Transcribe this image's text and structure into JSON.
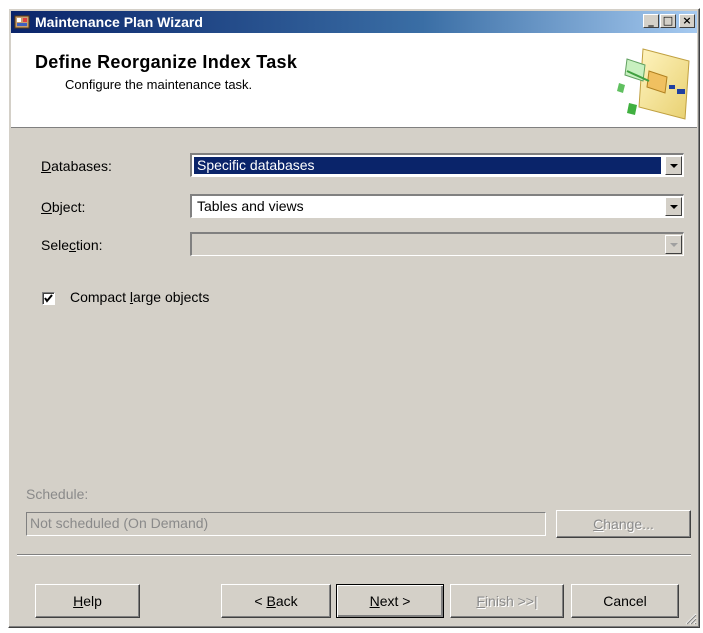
{
  "window": {
    "title": "Maintenance Plan Wizard",
    "controls": {
      "minimize": "_",
      "maximize": "□",
      "close": "×"
    }
  },
  "header": {
    "title": "Define Reorganize Index Task",
    "subtitle": "Configure the maintenance task."
  },
  "form": {
    "databases": {
      "label_pre": "",
      "label_key": "D",
      "label_post": "atabases:",
      "value": "Specific databases"
    },
    "object": {
      "label_pre": "",
      "label_key": "O",
      "label_post": "bject:",
      "value": "Tables and views"
    },
    "selection": {
      "label_pre": "Sele",
      "label_key": "c",
      "label_post": "tion:",
      "value": ""
    },
    "compact": {
      "label_pre": "Compact ",
      "label_key": "l",
      "label_post": "arge objects",
      "checked": true
    }
  },
  "schedule": {
    "label": "Schedule:",
    "value": "Not scheduled (On Demand)",
    "change_pre": "",
    "change_key": "C",
    "change_post": "hange..."
  },
  "buttons": {
    "help": {
      "pre": "",
      "key": "H",
      "post": "elp"
    },
    "back": {
      "pre": "< ",
      "key": "B",
      "post": "ack"
    },
    "next": {
      "pre": "",
      "key": "N",
      "post": "ext >"
    },
    "finish": {
      "pre": "",
      "key": "F",
      "post": "inish >>|"
    },
    "cancel": {
      "label": "Cancel"
    }
  },
  "colors": {
    "titlebar_start": "#0a246a",
    "dialog_bg": "#d4d0c8",
    "selection_highlight": "#0a246a"
  }
}
